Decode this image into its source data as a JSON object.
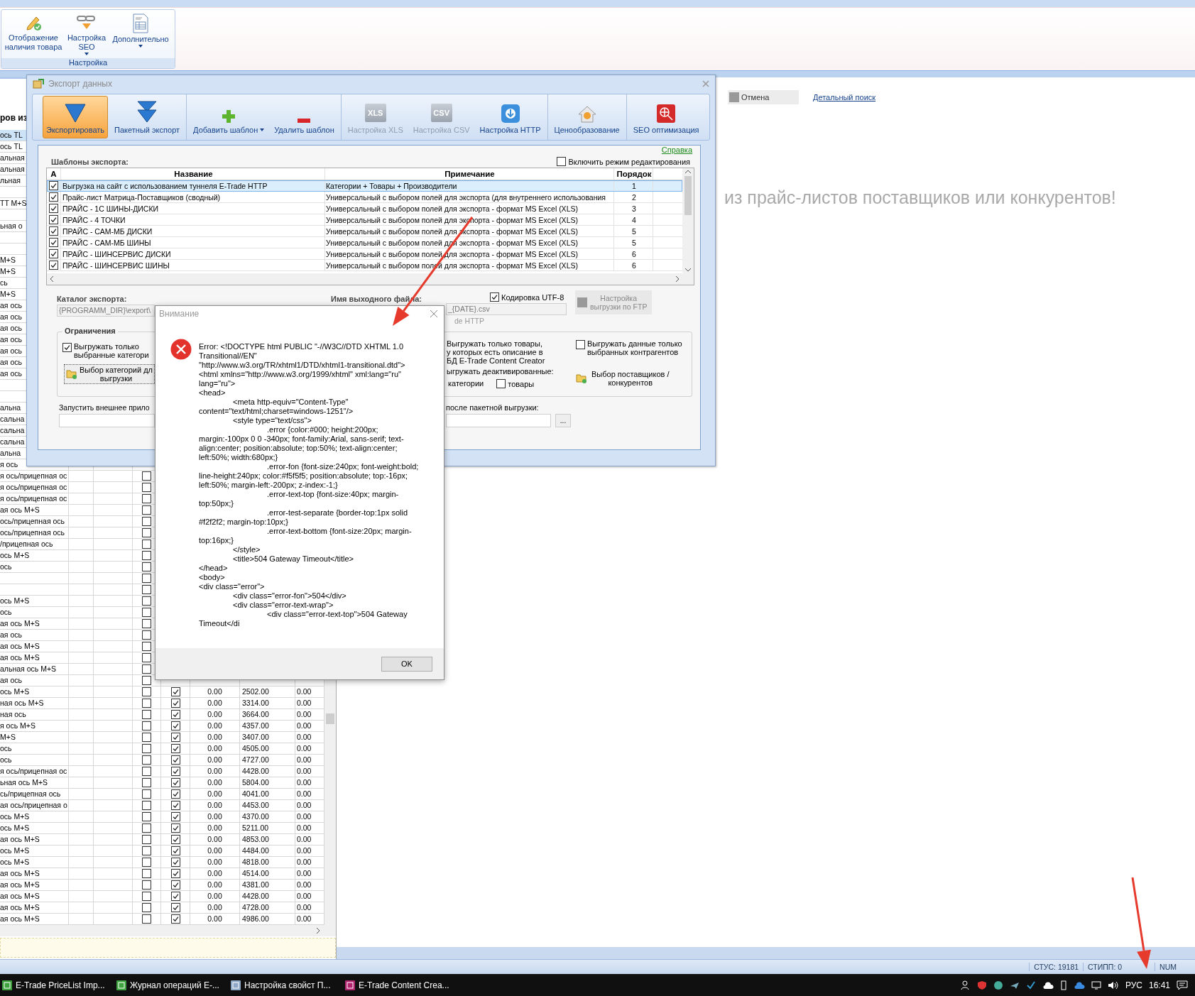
{
  "ribbon": {
    "group_label": "Настройка",
    "buttons": [
      {
        "label": "Отображение наличия товара",
        "dropdown": false
      },
      {
        "label": "Настройка SEO",
        "dropdown": true
      },
      {
        "label": "Дополнительно",
        "dropdown": true
      }
    ]
  },
  "background": {
    "list_caption": "ров из",
    "cancel_button": "Отмена",
    "detail_search_link": "Детальный поиск",
    "promo_text": "из прайс-листов поставщиков или конкурентов!",
    "rows": [
      {
        "text": "ось TL",
        "selected": true
      },
      {
        "text": "ось TL",
        "selected": false
      },
      {
        "text": "альная",
        "selected": false
      },
      {
        "text": "альная",
        "selected": false
      },
      {
        "text": "льная",
        "selected": false
      },
      {
        "selected": false
      },
      {
        "text": "TT M+S",
        "selected": false
      },
      {
        "selected": false
      },
      {
        "text": "ьная о",
        "selected": false
      },
      {
        "selected": false
      },
      {
        "selected": false
      },
      {
        "text": "M+S",
        "selected": false
      },
      {
        "text": "M+S",
        "selected": false
      },
      {
        "text": "сь",
        "selected": false
      },
      {
        "text": "M+S",
        "selected": false
      },
      {
        "text": "ая ось",
        "selected": false
      },
      {
        "text": "ая ось",
        "selected": false
      },
      {
        "text": "ая ось",
        "selected": false
      },
      {
        "text": "ая ось",
        "selected": false
      },
      {
        "text": "ая ось",
        "selected": false
      },
      {
        "text": "ая ось",
        "selected": false
      },
      {
        "text": "ая ось",
        "selected": false
      },
      {
        "selected": false
      },
      {
        "selected": false
      },
      {
        "text": "альна",
        "selected": false
      },
      {
        "text": "сальна",
        "selected": false
      },
      {
        "text": "сальна",
        "selected": false
      },
      {
        "text": "сальна",
        "selected": false
      },
      {
        "text": "альна",
        "selected": false
      },
      {
        "text": "я ось",
        "selected": false
      },
      {
        "text": "я ось/прицепная ос",
        "selected": false,
        "flag": false
      },
      {
        "text": "я ось/прицепная ос",
        "selected": false,
        "flag": false
      },
      {
        "text": "я ось/прицепная ос",
        "selected": false,
        "flag": false
      },
      {
        "text": "ая ось M+S",
        "selected": false,
        "flag": false
      },
      {
        "text": "ось/прицепная ось",
        "selected": false,
        "flag": false
      },
      {
        "text": "ось/прицепная ось",
        "selected": false,
        "flag": false
      },
      {
        "text": "/прицепная ось",
        "selected": false,
        "flag": false
      },
      {
        "text": "ось M+S",
        "selected": false,
        "flag": false
      },
      {
        "text": "ось",
        "selected": false,
        "flag": false
      },
      {
        "selected": false,
        "flag": false
      },
      {
        "selected": false,
        "flag": false
      },
      {
        "text": "ось M+S",
        "selected": false,
        "flag": false
      },
      {
        "text": "ось",
        "selected": false,
        "flag": false
      },
      {
        "text": "ая ось M+S",
        "selected": false,
        "flag": false
      },
      {
        "text": "ая ось",
        "selected": false,
        "flag": false
      },
      {
        "text": "ая ось M+S",
        "selected": false,
        "flag": false
      },
      {
        "text": "ая ось M+S",
        "selected": false,
        "flag": false
      },
      {
        "text": "альная ось M+S",
        "selected": false,
        "flag": false
      },
      {
        "text": "ая ось",
        "selected": false,
        "flag": false
      },
      {
        "text": "ось M+S",
        "selected": false,
        "flag": false,
        "active": true,
        "col_a": "0.00",
        "col_b": "2502.00",
        "col_c": "0.00"
      },
      {
        "text": "ная ось M+S",
        "selected": false,
        "flag": false,
        "active": true,
        "col_a": "0.00",
        "col_b": "3314.00",
        "col_c": "0.00"
      },
      {
        "text": "ная ось",
        "selected": false,
        "flag": false,
        "active": true,
        "col_a": "0.00",
        "col_b": "3664.00",
        "col_c": "0.00"
      },
      {
        "text": "я ось M+S",
        "selected": false,
        "flag": false,
        "active": true,
        "col_a": "0.00",
        "col_b": "4357.00",
        "col_c": "0.00"
      },
      {
        "text": "M+S",
        "selected": false,
        "flag": false,
        "active": true,
        "col_a": "0.00",
        "col_b": "3407.00",
        "col_c": "0.00"
      },
      {
        "text": "ось",
        "selected": false,
        "flag": false,
        "active": true,
        "col_a": "0.00",
        "col_b": "4505.00",
        "col_c": "0.00"
      },
      {
        "text": "ось",
        "selected": false,
        "flag": false,
        "active": true,
        "col_a": "0.00",
        "col_b": "4727.00",
        "col_c": "0.00"
      },
      {
        "text": "я ось/прицепная ос",
        "selected": false,
        "flag": false,
        "active": true,
        "col_a": "0.00",
        "col_b": "4428.00",
        "col_c": "0.00"
      },
      {
        "text": "ьная ось M+S",
        "selected": false,
        "flag": false,
        "active": true,
        "col_a": "0.00",
        "col_b": "5804.00",
        "col_c": "0.00"
      },
      {
        "text": "сь/прицепная ось",
        "selected": false,
        "flag": false,
        "active": true,
        "col_a": "0.00",
        "col_b": "4041.00",
        "col_c": "0.00"
      },
      {
        "text": "ая ось/прицепная о",
        "selected": false,
        "flag": false,
        "active": true,
        "col_a": "0.00",
        "col_b": "4453.00",
        "col_c": "0.00"
      },
      {
        "text": "ось M+S",
        "selected": false,
        "flag": false,
        "active": true,
        "col_a": "0.00",
        "col_b": "4370.00",
        "col_c": "0.00"
      },
      {
        "text": "ось M+S",
        "selected": false,
        "flag": false,
        "active": true,
        "col_a": "0.00",
        "col_b": "5211.00",
        "col_c": "0.00"
      },
      {
        "text": "ая ось M+S",
        "selected": false,
        "flag": false,
        "active": true,
        "col_a": "0.00",
        "col_b": "4853.00",
        "col_c": "0.00"
      },
      {
        "text": "ось M+S",
        "selected": false,
        "flag": false,
        "active": true,
        "col_a": "0.00",
        "col_b": "4484.00",
        "col_c": "0.00"
      },
      {
        "text": "ось M+S",
        "selected": false,
        "flag": false,
        "active": true,
        "col_a": "0.00",
        "col_b": "4818.00",
        "col_c": "0.00"
      },
      {
        "text": "ая ось M+S",
        "selected": false,
        "flag": false,
        "active": true,
        "col_a": "0.00",
        "col_b": "4514.00",
        "col_c": "0.00"
      },
      {
        "text": "ая ось M+S",
        "selected": false,
        "flag": false,
        "active": true,
        "col_a": "0.00",
        "col_b": "4381.00",
        "col_c": "0.00"
      },
      {
        "text": "ая ось M+S",
        "selected": false,
        "flag": false,
        "active": true,
        "col_a": "0.00",
        "col_b": "4428.00",
        "col_c": "0.00"
      },
      {
        "text": "ая ось M+S",
        "selected": false,
        "flag": false,
        "active": true,
        "col_a": "0.00",
        "col_b": "4728.00",
        "col_c": "0.00"
      },
      {
        "text": "ая ось M+S",
        "selected": false,
        "flag": false,
        "active": true,
        "col_a": "0.00",
        "col_b": "4986.00",
        "col_c": "0.00"
      }
    ]
  },
  "export_window": {
    "title": "Экспорт данных",
    "toolbar": [
      [
        {
          "label": "Экспортировать",
          "selected": true,
          "disabled": false,
          "dropdown": false
        },
        {
          "label": "Пакетный экспорт",
          "selected": false,
          "disabled": false,
          "dropdown": false
        }
      ],
      [
        {
          "label": "Добавить шаблон",
          "selected": false,
          "disabled": false,
          "dropdown": true
        },
        {
          "label": "Удалить шаблон",
          "selected": false,
          "disabled": false,
          "dropdown": false
        }
      ],
      [
        {
          "label": "Настройка XLS",
          "badge": "XLS",
          "selected": false,
          "disabled": true,
          "dropdown": false
        },
        {
          "label": "Настройка CSV",
          "badge": "CSV",
          "selected": false,
          "disabled": true,
          "dropdown": false
        },
        {
          "label": "Настройка HTTP",
          "selected": false,
          "disabled": false,
          "dropdown": false
        }
      ],
      [
        {
          "label": "Ценообразование",
          "selected": false,
          "disabled": false,
          "dropdown": false
        }
      ],
      [
        {
          "label": "SEO оптимизация",
          "selected": false,
          "disabled": false,
          "dropdown": false
        }
      ]
    ],
    "help_link": "Справка",
    "templates": {
      "caption": "Шаблоны экспорта:",
      "edit_mode": {
        "label": "Включить режим редактирования",
        "checked": false
      },
      "columns": [
        "A",
        "Название",
        "Примечание",
        "Порядок"
      ],
      "rows": [
        {
          "checked": true,
          "selected": true,
          "name": "Выгрузка на сайт с использованием туннеля E-Trade HTTP",
          "note": "Категории + Товары + Производители",
          "order": "1"
        },
        {
          "checked": true,
          "selected": false,
          "name": "Прайс-лист Матрица-Поставщиков (сводный)",
          "note": "Универсальный с выбором полей для экспорта (для внутреннего использования",
          "order": "2"
        },
        {
          "checked": true,
          "selected": false,
          "name": "ПРАЙС - 1С ШИНЫ-ДИСКИ",
          "note": "Универсальный с выбором полей для экспорта - формат MS Excel (XLS)",
          "order": "3"
        },
        {
          "checked": true,
          "selected": false,
          "name": "ПРАЙС - 4 ТОЧКИ",
          "note": "Универсальный с выбором полей для экспорта - формат MS Excel (XLS)",
          "order": "4"
        },
        {
          "checked": true,
          "selected": false,
          "name": "ПРАЙС - САМ-МБ ДИСКИ",
          "note": "Универсальный с выбором полей для экспорта - формат MS Excel (XLS)",
          "order": "5"
        },
        {
          "checked": true,
          "selected": false,
          "name": "ПРАЙС - САМ-МБ ШИНЫ",
          "note": "Универсальный с выбором полей для экспорта - формат MS Excel (XLS)",
          "order": "5"
        },
        {
          "checked": true,
          "selected": false,
          "name": "ПРАЙС - ШИНСЕРВИС ДИСКИ",
          "note": "Универсальный с выбором полей для экспорта - формат MS Excel (XLS)",
          "order": "6"
        },
        {
          "checked": true,
          "selected": false,
          "name": "ПРАЙС - ШИНСЕРВИС ШИНЫ",
          "note": "Универсальный с выбором полей для экспорта - формат MS Excel (XLS)",
          "order": "6"
        }
      ]
    },
    "catalog": {
      "label": "Каталог экспорта:",
      "value": "{PROGRAMM_DIR}\\export\\"
    },
    "filename": {
      "label": "Имя выходного файла:",
      "value": "_{DATE}.csv",
      "note": "de HTTP"
    },
    "utf8": {
      "label": "Кодировка UTF-8",
      "checked": true
    },
    "ftp_button": {
      "lines": [
        "Настройка",
        "выгрузки по FTP"
      ],
      "disabled": true
    },
    "limits": {
      "caption": "Ограничения",
      "only_categories": {
        "lines": [
          "Выгружать только",
          "выбранные категори"
        ],
        "checked": true
      },
      "categories_button": [
        "Выбор категорий дл",
        "выгрузки"
      ],
      "only_described": [
        "Выгружать только товары,",
        "у которых есть описание в",
        "БД E-Trade Content Creator"
      ],
      "only_contractors": {
        "lines": [
          "Выгружать данные только",
          "выбранных контрагентов"
        ],
        "checked": false
      },
      "deactivated_label": "ыгружать деактивированные:",
      "deactivated_categories": "категории",
      "deactivated_goods": {
        "label": "товары",
        "checked": false
      },
      "suppliers_button": [
        "Выбор поставщиков /",
        "конкурентов"
      ]
    },
    "external_app": {
      "label": "Запустить внешнее прило",
      "label_right": "после пакетной выгрузки:",
      "browse": "..."
    }
  },
  "alert": {
    "title": "Внимание",
    "message": "Error: <!DOCTYPE html PUBLIC \"-//W3C//DTD XHTML 1.0 Transitional//EN\"\n\"http://www.w3.org/TR/xhtml1/DTD/xhtml1-transitional.dtd\">\n<html xmlns=\"http://www.w3.org/1999/xhtml\" xml:lang=\"ru\" lang=\"ru\">\n<head>\n\t<meta http-equiv=\"Content-Type\" content=\"text/html;charset=windows-1251\"/>\n\t<style type=\"text/css\">\n\t\t.error {color:#000; height:200px; margin:-100px 0 0 -340px; font-family:Arial, sans-serif; text-align:center; position:absolute; top:50%; text-align:center; left:50%; width:680px;}\n\t\t.error-fon {font-size:240px; font-weight:bold; line-height:240px; color:#f5f5f5; position:absolute; top:-16px; left:50%; margin-left:-200px; z-index:-1;}\n\t\t.error-text-top {font-size:40px; margin-top:50px;}\n\t\t.error-test-separate {border-top:1px solid #f2f2f2; margin-top:10px;}\n\t\t.error-text-bottom {font-size:20px; margin-top:16px;}\n\t</style>\n\t<title>504 Gateway Timeout</title>\n</head>\n<body>\n<div class=\"error\">\n\t<div class=\"error-fon\">504</div>\n\t<div class=\"error-text-wrap\">\n\t\t<div class=\"error-text-top\">504 Gateway Timeout</di",
    "ok": "OK"
  },
  "status_bar": [
    "СТУС: 19181",
    "СТИПП: 0",
    "NUM"
  ],
  "taskbar": {
    "apps": [
      "E-Trade PriceList Imp...",
      "Журнал операций E-...",
      "Настройка свойст П...",
      "E-Trade Content Crea..."
    ],
    "language": "РУС",
    "clock": "16:41"
  }
}
